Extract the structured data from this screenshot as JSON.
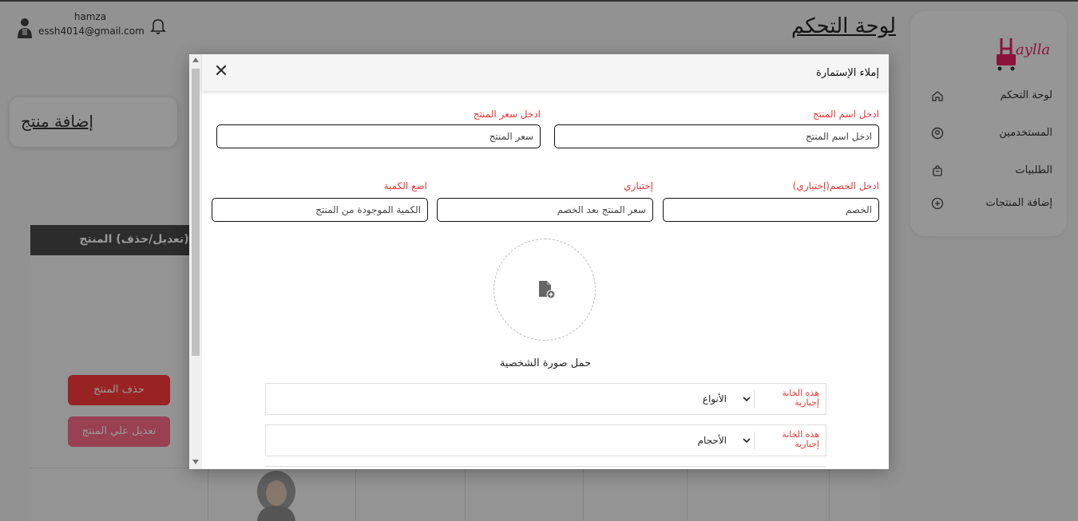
{
  "header": {
    "user_name": "hamza",
    "user_email": "essh4014@gmail.com",
    "page_title": "لوحة التحكم"
  },
  "sidebar": {
    "logo_text": "Haylla",
    "items": [
      {
        "label": "لوحة التحكم",
        "icon": "home-icon"
      },
      {
        "label": "المستخدمين",
        "icon": "user-circle-icon"
      },
      {
        "label": "الطلبيات",
        "icon": "shopping-bag-icon"
      },
      {
        "label": "إضافة المنتجات",
        "icon": "plus-circle-icon"
      }
    ]
  },
  "main": {
    "add_product_card_title": "إضافة منتج",
    "table_header": "(تعديل/حذف) المنتج",
    "delete_button": "حذف المنتج",
    "edit_button": "تعديل علي المنتج"
  },
  "modal": {
    "title": "إملاء الإستمارة",
    "fields": {
      "name_label": "ادخل اسم المنتج",
      "name_placeholder": "ادخل اسم المنتج",
      "price_label": "ادخل سعر المنتج",
      "price_placeholder": "سعر المنتج",
      "discount_label": "ادخل الخصم(إختياري)",
      "discount_placeholder": "الخصم",
      "after_discount_label": "إختياري",
      "after_discount_placeholder": "سعر المنتج بعد الخصم",
      "quantity_label": "اضع الكمية",
      "quantity_placeholder": "الكمية الموجودة من المنتج"
    },
    "upload_label": "حمل صورة الشخصية",
    "selects": [
      {
        "required_text": "هذه الخانة إجبارية",
        "value": "الأنواع"
      },
      {
        "required_text": "هذه الخانة إجبارية",
        "value": "الأحجام"
      }
    ]
  },
  "colors": {
    "accent_red": "#e53935",
    "delete_button": "#ff3b3b",
    "edit_button": "#ff6b8b",
    "logo_pink": "#e91e63",
    "overlay": "rgba(0,0,0,0.40)"
  }
}
